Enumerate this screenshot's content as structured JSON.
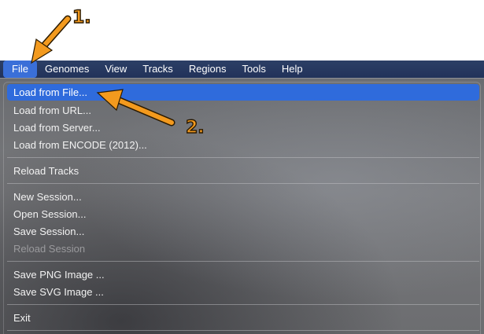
{
  "menubar": {
    "items": [
      "File",
      "Genomes",
      "View",
      "Tracks",
      "Regions",
      "Tools",
      "Help"
    ]
  },
  "file_menu": {
    "load_from_file": "Load from File...",
    "load_from_url": "Load from URL...",
    "load_from_server": "Load from Server...",
    "load_from_encode": "Load from ENCODE (2012)...",
    "reload_tracks": "Reload Tracks",
    "new_session": "New Session...",
    "open_session": "Open Session...",
    "save_session": "Save Session...",
    "reload_session": "Reload Session",
    "save_png": "Save PNG Image ...",
    "save_svg": "Save SVG Image ...",
    "exit": "Exit"
  },
  "annotations": {
    "step1": "1.",
    "step2": "2."
  },
  "colors": {
    "menubar": "#22325a",
    "selection": "#2f6bdc",
    "callout": "#f39a1e"
  }
}
